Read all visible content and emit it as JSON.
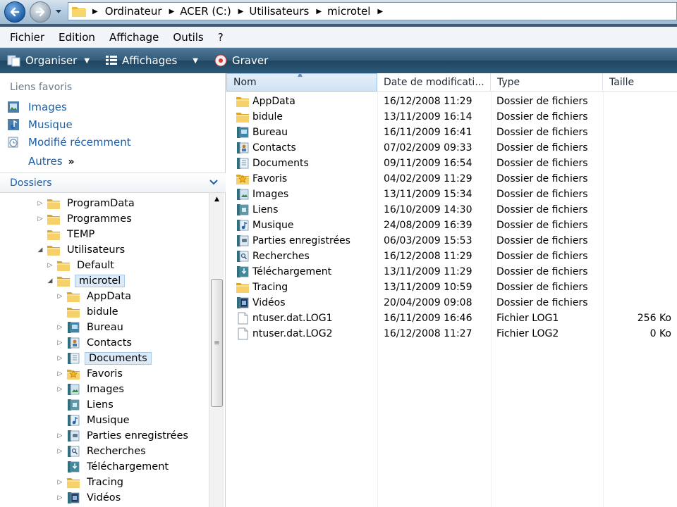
{
  "window": {
    "breadcrumbs": [
      "Ordinateur",
      "ACER (C:)",
      "Utilisateurs",
      "microtel"
    ]
  },
  "menu": [
    "Fichier",
    "Edition",
    "Affichage",
    "Outils",
    "?"
  ],
  "toolbar": {
    "organise": "Organiser",
    "views": "Affichages",
    "burn": "Graver"
  },
  "favorites": {
    "header": "Liens favoris",
    "items": [
      {
        "label": "Images",
        "icon": "pictures-icon"
      },
      {
        "label": "Musique",
        "icon": "music-icon"
      },
      {
        "label": "Modifié récemment",
        "icon": "recent-icon"
      }
    ],
    "more": "Autres",
    "more_glyph": "»"
  },
  "folders": {
    "header": "Dossiers",
    "tree": [
      {
        "label": "ProgramData",
        "level": 0,
        "expander": "collapsed",
        "icon": "folder-icon"
      },
      {
        "label": "Programmes",
        "level": 0,
        "expander": "collapsed",
        "icon": "folder-icon"
      },
      {
        "label": "TEMP",
        "level": 0,
        "expander": "none",
        "icon": "folder-icon"
      },
      {
        "label": "Utilisateurs",
        "level": 0,
        "expander": "expanded",
        "icon": "folder-icon"
      },
      {
        "label": "Default",
        "level": 1,
        "expander": "collapsed",
        "icon": "folder-icon"
      },
      {
        "label": "microtel",
        "level": 1,
        "expander": "expanded",
        "icon": "folder-icon",
        "selected": true
      },
      {
        "label": "AppData",
        "level": 2,
        "expander": "collapsed",
        "icon": "folder-icon"
      },
      {
        "label": "bidule",
        "level": 2,
        "expander": "none",
        "icon": "folder-icon"
      },
      {
        "label": "Bureau",
        "level": 2,
        "expander": "collapsed",
        "icon": "desktop-folder-icon"
      },
      {
        "label": "Contacts",
        "level": 2,
        "expander": "collapsed",
        "icon": "contacts-folder-icon"
      },
      {
        "label": "Documents",
        "level": 2,
        "expander": "collapsed",
        "icon": "documents-folder-icon",
        "highlight": true
      },
      {
        "label": "Favoris",
        "level": 2,
        "expander": "collapsed",
        "icon": "favorites-folder-icon"
      },
      {
        "label": "Images",
        "level": 2,
        "expander": "collapsed",
        "icon": "pictures-folder-icon"
      },
      {
        "label": "Liens",
        "level": 2,
        "expander": "none",
        "icon": "links-folder-icon"
      },
      {
        "label": "Musique",
        "level": 2,
        "expander": "none",
        "icon": "music-folder-icon"
      },
      {
        "label": "Parties enregistrées",
        "level": 2,
        "expander": "collapsed",
        "icon": "saved-games-folder-icon"
      },
      {
        "label": "Recherches",
        "level": 2,
        "expander": "collapsed",
        "icon": "searches-folder-icon"
      },
      {
        "label": "Téléchargement",
        "level": 2,
        "expander": "none",
        "icon": "downloads-folder-icon"
      },
      {
        "label": "Tracing",
        "level": 2,
        "expander": "collapsed",
        "icon": "folder-icon"
      },
      {
        "label": "Vidéos",
        "level": 2,
        "expander": "collapsed",
        "icon": "videos-folder-icon"
      }
    ]
  },
  "columns": {
    "name": "Nom",
    "date": "Date de modificati...",
    "type": "Type",
    "size": "Taille"
  },
  "files": [
    {
      "name": "AppData",
      "date": "16/12/2008 11:29",
      "type": "Dossier de fichiers",
      "size": "",
      "icon": "folder-icon"
    },
    {
      "name": "bidule",
      "date": "13/11/2009 16:14",
      "type": "Dossier de fichiers",
      "size": "",
      "icon": "folder-icon"
    },
    {
      "name": "Bureau",
      "date": "16/11/2009 16:41",
      "type": "Dossier de fichiers",
      "size": "",
      "icon": "desktop-folder-icon"
    },
    {
      "name": "Contacts",
      "date": "07/02/2009 09:33",
      "type": "Dossier de fichiers",
      "size": "",
      "icon": "contacts-folder-icon"
    },
    {
      "name": "Documents",
      "date": "09/11/2009 16:54",
      "type": "Dossier de fichiers",
      "size": "",
      "icon": "documents-folder-icon"
    },
    {
      "name": "Favoris",
      "date": "04/02/2009 11:29",
      "type": "Dossier de fichiers",
      "size": "",
      "icon": "favorites-folder-icon"
    },
    {
      "name": "Images",
      "date": "13/11/2009 15:34",
      "type": "Dossier de fichiers",
      "size": "",
      "icon": "pictures-folder-icon"
    },
    {
      "name": "Liens",
      "date": "16/10/2009 14:30",
      "type": "Dossier de fichiers",
      "size": "",
      "icon": "links-folder-icon"
    },
    {
      "name": "Musique",
      "date": "24/08/2009 16:39",
      "type": "Dossier de fichiers",
      "size": "",
      "icon": "music-folder-icon"
    },
    {
      "name": "Parties enregistrées",
      "date": "06/03/2009 15:53",
      "type": "Dossier de fichiers",
      "size": "",
      "icon": "saved-games-folder-icon"
    },
    {
      "name": "Recherches",
      "date": "16/12/2008 11:29",
      "type": "Dossier de fichiers",
      "size": "",
      "icon": "searches-folder-icon"
    },
    {
      "name": "Téléchargement",
      "date": "13/11/2009 11:29",
      "type": "Dossier de fichiers",
      "size": "",
      "icon": "downloads-folder-icon"
    },
    {
      "name": "Tracing",
      "date": "13/11/2009 10:59",
      "type": "Dossier de fichiers",
      "size": "",
      "icon": "folder-icon"
    },
    {
      "name": "Vidéos",
      "date": "20/04/2009 09:08",
      "type": "Dossier de fichiers",
      "size": "",
      "icon": "videos-folder-icon"
    },
    {
      "name": "ntuser.dat.LOG1",
      "date": "16/11/2009 16:46",
      "type": "Fichier LOG1",
      "size": "256 Ko",
      "icon": "file-icon"
    },
    {
      "name": "ntuser.dat.LOG2",
      "date": "16/12/2008 11:27",
      "type": "Fichier LOG2",
      "size": "0 Ko",
      "icon": "file-icon"
    }
  ],
  "colors": {
    "link": "#1c5fa8",
    "folder": "#f2c94c",
    "selection": "#dceaf7",
    "toolbar": "#2c5979"
  }
}
